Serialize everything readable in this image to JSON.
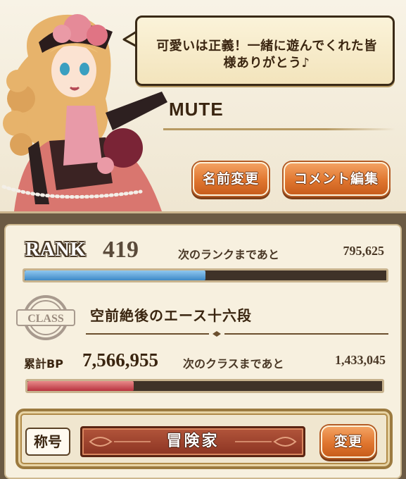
{
  "profile": {
    "comment": "可愛いは正義！一緒に遊んでくれた皆様ありがとう♪",
    "name": "MUTE",
    "rename_button": "名前変更",
    "comment_edit_button": "コメント編集"
  },
  "rank": {
    "label": "RANK",
    "value": "419",
    "next_label": "次のランクまであと",
    "next_value": "795,625",
    "progress": 0.5
  },
  "class": {
    "emblem_text": "CLASS",
    "title": "空前絶後のエース十六段",
    "bp_label": "累計BP",
    "bp_value": "7,566,955",
    "next_label": "次のクラスまであと",
    "next_value": "1,433,045",
    "progress": 0.3
  },
  "title_strip": {
    "label": "称号",
    "value": "冒険家",
    "change_button": "変更"
  },
  "colors": {
    "accent_orange": "#e0762f",
    "rank_bar": "#3e89c7",
    "bp_bar": "#b8323f"
  }
}
